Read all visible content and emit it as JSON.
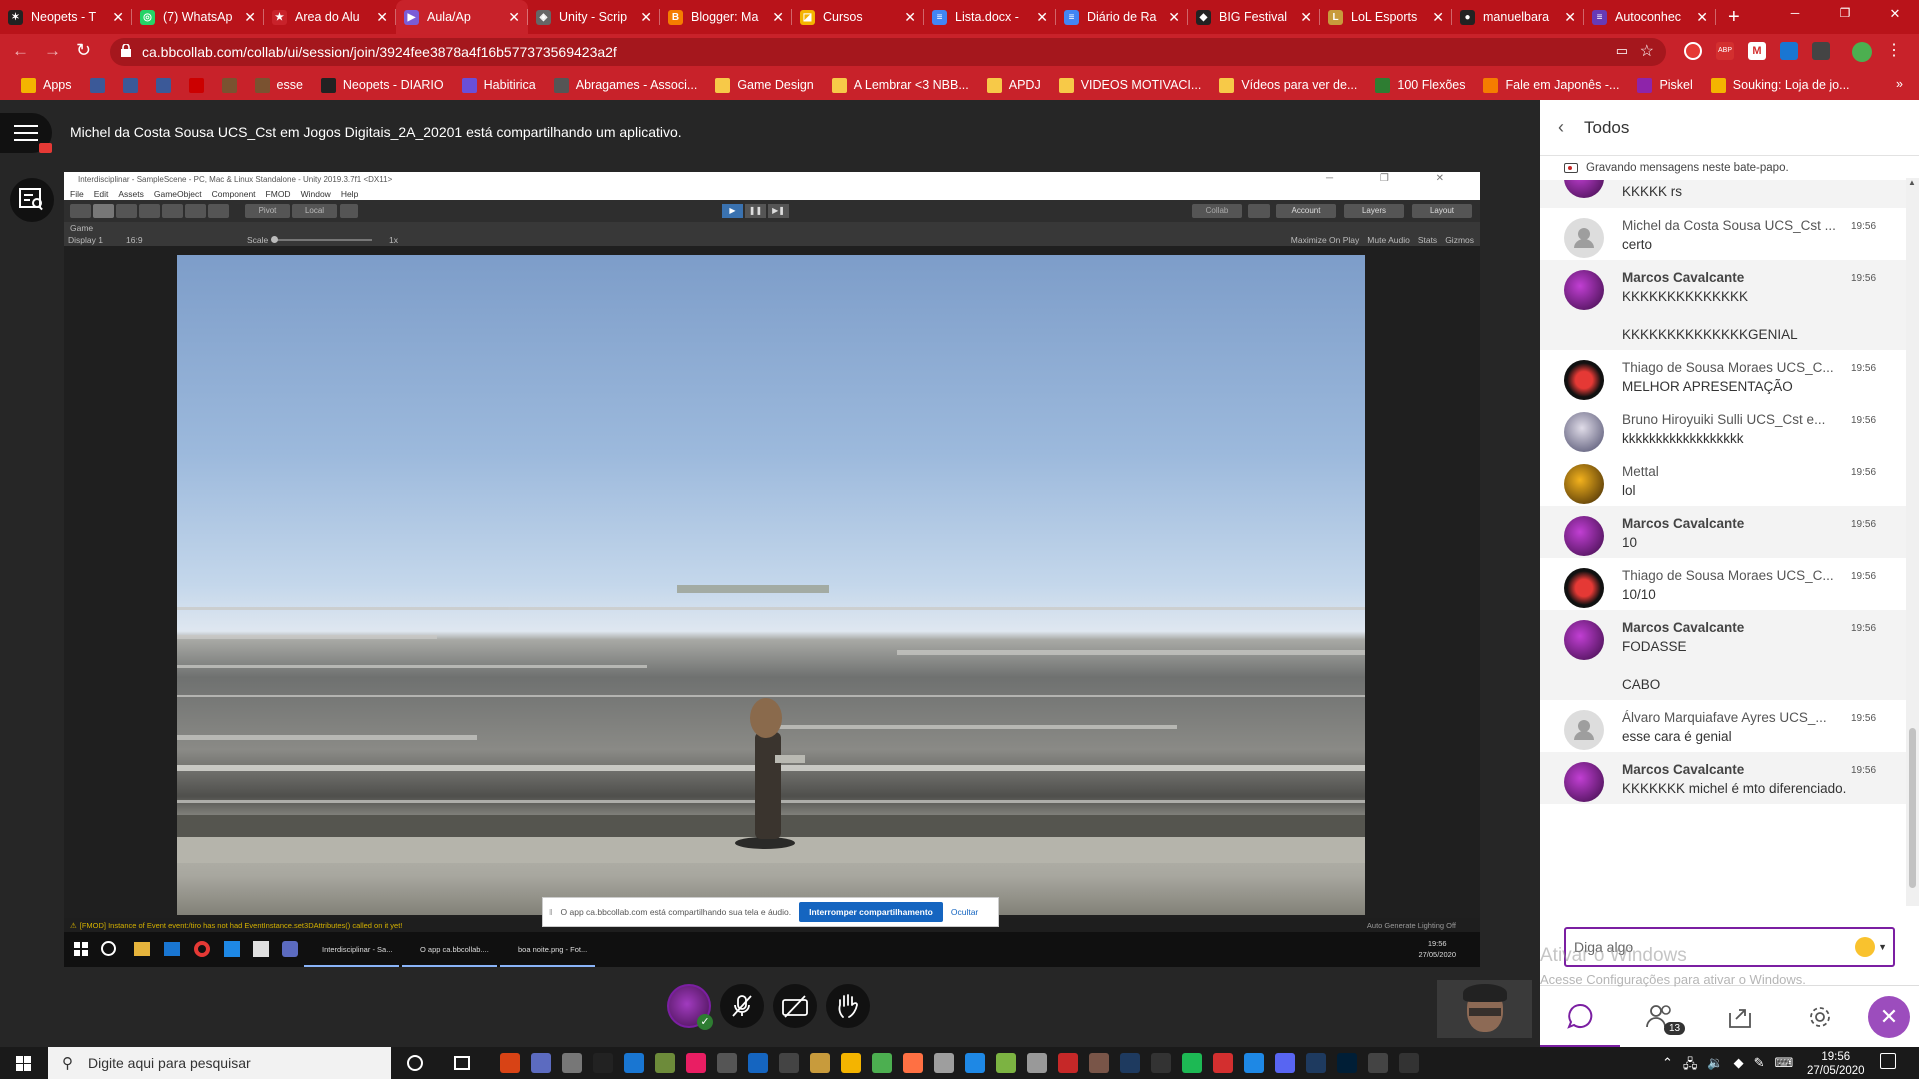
{
  "browser": {
    "tabs": [
      {
        "title": "Neopets - T",
        "color": "#222",
        "glyph": "✶"
      },
      {
        "title": "(7) WhatsAp",
        "color": "#25d366",
        "glyph": "◎"
      },
      {
        "title": "Area do Alu",
        "color": "#c8222a",
        "glyph": "★"
      },
      {
        "title": "Aula/Ap",
        "color": "#7b5cd6",
        "glyph": "▶",
        "active": true
      },
      {
        "title": "Unity - Scrip",
        "color": "#666",
        "glyph": "◈"
      },
      {
        "title": "Blogger: Ma",
        "color": "#f57d00",
        "glyph": "B"
      },
      {
        "title": "Cursos",
        "color": "#f4b400",
        "glyph": "◪"
      },
      {
        "title": "Lista.docx - ",
        "color": "#4285f4",
        "glyph": "≡"
      },
      {
        "title": "Diário de Ra",
        "color": "#4285f4",
        "glyph": "≡"
      },
      {
        "title": "BIG Festival",
        "color": "#222",
        "glyph": "◆"
      },
      {
        "title": "LoL Esports",
        "color": "#c89b3c",
        "glyph": "L"
      },
      {
        "title": "manuelbara",
        "color": "#222",
        "glyph": "●"
      },
      {
        "title": "Autoconhec",
        "color": "#673ab7",
        "glyph": "≡"
      }
    ],
    "new_tab": "+",
    "url": "ca.bbcollab.com/collab/ui/session/join/3924fee3878a4f16b577373569423a2f",
    "bookmarks": [
      {
        "label": "Apps",
        "color": "#f4b400"
      },
      {
        "label": "",
        "color": "#3b5998"
      },
      {
        "label": "",
        "color": "#3b5998"
      },
      {
        "label": "",
        "color": "#3b5998"
      },
      {
        "label": "",
        "color": "#c00"
      },
      {
        "label": "",
        "color": "#7a5230"
      },
      {
        "label": "esse",
        "color": "#7a5230"
      },
      {
        "label": "Neopets - DIARIO",
        "color": "#222"
      },
      {
        "label": "Habitirica",
        "color": "#6a4fd8"
      },
      {
        "label": "Abragames - Associ...",
        "color": "#555"
      },
      {
        "label": "Game Design",
        "color": "#f7c948"
      },
      {
        "label": "A Lembrar <3 NBB...",
        "color": "#f7c948"
      },
      {
        "label": "APDJ",
        "color": "#f7c948"
      },
      {
        "label": "VIDEOS MOTIVACI...",
        "color": "#f7c948"
      },
      {
        "label": "Vídeos para ver de...",
        "color": "#f7c948"
      },
      {
        "label": "100 Flexões",
        "color": "#2e7d32"
      },
      {
        "label": "Fale em Japonês -...",
        "color": "#f57d00"
      },
      {
        "label": "Piskel",
        "color": "#8e24aa"
      },
      {
        "label": "Souking: Loja de jo...",
        "color": "#f4b400"
      }
    ],
    "bookmarks_more": "»",
    "window_controls": {
      "minimize": "─",
      "restore": "❐",
      "close": "✕"
    }
  },
  "collab": {
    "share_notice": "Michel da Costa Sousa UCS_Cst em Jogos Digitais_2A_20201 está compartilhando um aplicativo.",
    "shared_screen": {
      "window_title": "Interdisciplinar - SampleScene - PC, Mac & Linux Standalone - Unity 2019.3.7f1 <DX11>",
      "menu": [
        "File",
        "Edit",
        "Assets",
        "GameObject",
        "Component",
        "FMOD",
        "Window",
        "Help"
      ],
      "toolbar": {
        "pivot": "Pivot",
        "local": "Local",
        "collab": "Collab",
        "account": "Account",
        "layers": "Layers",
        "layout": "Layout"
      },
      "game_tab": "Game",
      "display": "Display 1",
      "aspect": "16:9",
      "scale_label": "Scale",
      "scale_value": "1x",
      "game_options": [
        "Maximize On Play",
        "Mute Audio",
        "Stats",
        "Gizmos"
      ],
      "status_message": "[FMOD] Instance of Event event:/tiro has not had EventInstance.set3DAttributes() called on it yet!",
      "status_right": "Auto Generate Lighting Off",
      "share_bar": {
        "message": "O app ca.bbcollab.com está compartilhando sua tela e áudio.",
        "stop_button": "Interromper compartilhamento",
        "hide_button": "Ocultar"
      },
      "taskbar_items": [
        "Interdisciplinar - Sa...",
        "O app ca.bbcollab....",
        "boa noite.png - Fot..."
      ],
      "clock_time": "19:56",
      "clock_date": "27/05/2020"
    }
  },
  "chat": {
    "header": "Todos",
    "recording_note": "Gravando mensagens neste bate-papo.",
    "input_placeholder": "Diga algo",
    "participants_count": "13",
    "watermark_title": "Ativar o Windows",
    "watermark_sub": "Acesse Configurações para ativar o Windows.",
    "messages": [
      {
        "name": "",
        "time": "",
        "lines": [
          "KKKKK rs"
        ],
        "avatar": "purple",
        "moderator": true
      },
      {
        "name": "Michel da Costa Sousa UCS_Cst ...",
        "time": "19:56",
        "lines": [
          "certo"
        ],
        "avatar": "default",
        "moderator": false
      },
      {
        "name": "Marcos Cavalcante",
        "time": "19:56",
        "lines": [
          "KKKKKKKKKKKKKK",
          "KKKKKKKKKKKKKKGENIAL"
        ],
        "avatar": "purple",
        "moderator": true
      },
      {
        "name": "Thiago de Sousa Moraes UCS_C...",
        "time": "19:56",
        "lines": [
          "MELHOR APRESENTAÇÃO"
        ],
        "avatar": "red",
        "moderator": false
      },
      {
        "name": "Bruno Hiroyuiki Sulli UCS_Cst e...",
        "time": "19:56",
        "lines": [
          "kkkkkkkkkkkkkkkkkk"
        ],
        "avatar": "anime",
        "moderator": false
      },
      {
        "name": "Mettal",
        "time": "19:56",
        "lines": [
          "lol"
        ],
        "avatar": "gold",
        "moderator": false
      },
      {
        "name": "Marcos Cavalcante",
        "time": "19:56",
        "lines": [
          "10"
        ],
        "avatar": "purple",
        "moderator": true
      },
      {
        "name": "Thiago de Sousa Moraes UCS_C...",
        "time": "19:56",
        "lines": [
          "10/10"
        ],
        "avatar": "red",
        "moderator": false
      },
      {
        "name": "Marcos Cavalcante",
        "time": "19:56",
        "lines": [
          "FODASSE",
          "CABO"
        ],
        "avatar": "purple",
        "moderator": true
      },
      {
        "name": "Álvaro Marquiafave Ayres UCS_...",
        "time": "19:56",
        "lines": [
          "esse cara é genial"
        ],
        "avatar": "default",
        "moderator": false
      },
      {
        "name": "Marcos Cavalcante",
        "time": "19:56",
        "lines": [
          "KKKKKKK michel é mto diferenciado."
        ],
        "avatar": "purple",
        "moderator": true
      }
    ]
  },
  "taskbar": {
    "search_placeholder": "Digite aqui para pesquisar",
    "time": "19:56",
    "date": "27/05/2020"
  },
  "colors": {
    "chrome_red": "#c8222a",
    "collab_purple": "#7b1fa2",
    "share_blue": "#1565c0"
  }
}
